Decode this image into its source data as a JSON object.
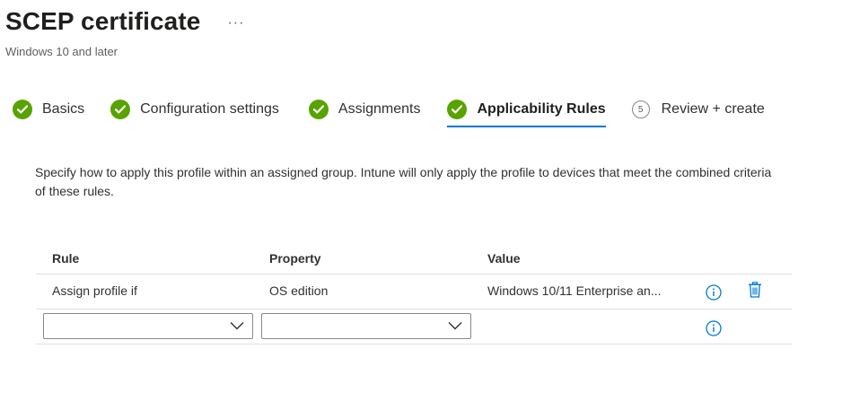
{
  "header": {
    "title": "SCEP certificate",
    "more_icon": "ellipsis-icon",
    "subtitle": "Windows 10 and later"
  },
  "wizard": {
    "steps": [
      {
        "label": "Basics",
        "state": "complete"
      },
      {
        "label": "Configuration settings",
        "state": "complete"
      },
      {
        "label": "Assignments",
        "state": "complete"
      },
      {
        "label": "Applicability Rules",
        "state": "active"
      },
      {
        "label": "Review + create",
        "state": "pending",
        "number": "5"
      }
    ]
  },
  "description": "Specify how to apply this profile within an assigned group. Intune will only apply the profile to devices that meet the combined criteria of these rules.",
  "rules_table": {
    "headers": {
      "rule": "Rule",
      "property": "Property",
      "value": "Value"
    },
    "rows": [
      {
        "rule": "Assign profile if",
        "property": "OS edition",
        "value": "Windows 10/11 Enterprise an..."
      }
    ],
    "new_row": {
      "rule_selected": "",
      "property_selected": ""
    }
  },
  "colors": {
    "accent": "#0078d4",
    "success": "#57a300",
    "border": "#e1dfdd"
  }
}
